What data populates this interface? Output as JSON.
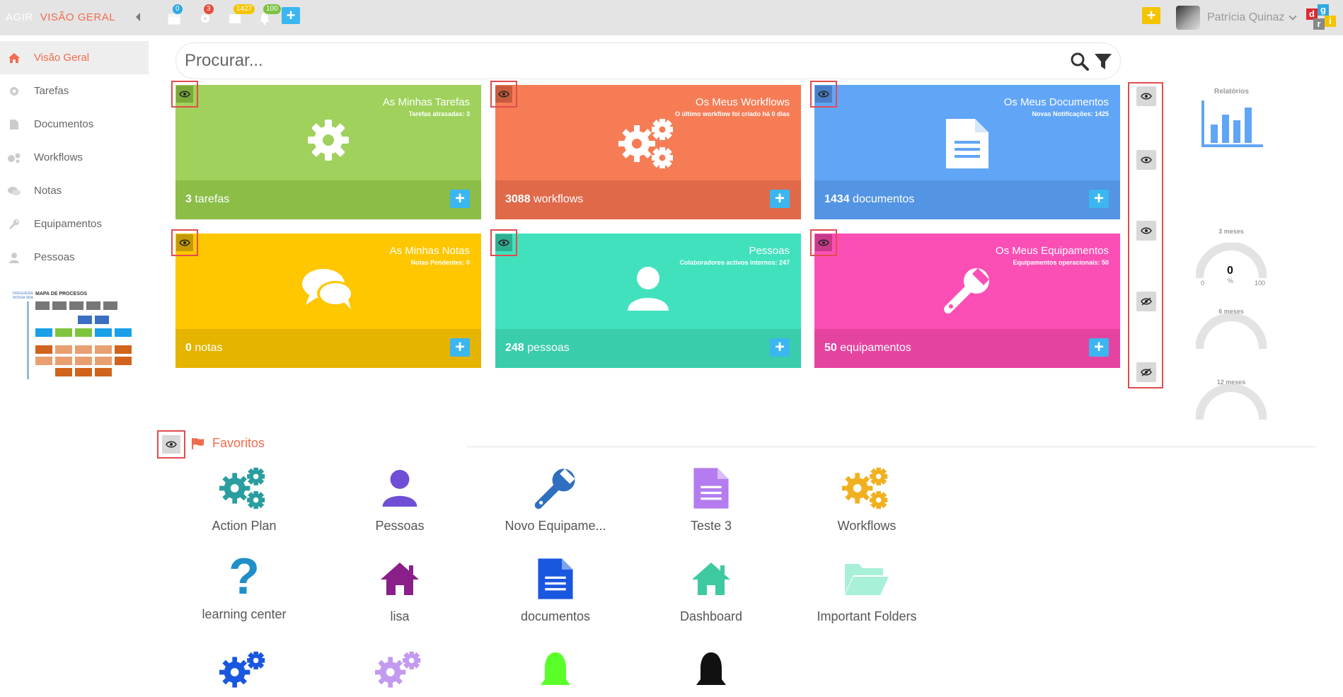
{
  "topbar": {
    "app_name": "AGIR",
    "breadcrumb": "VISÃO GERAL",
    "badges": {
      "calendar": "0",
      "tasks": "3",
      "documents": "1427",
      "notifications": "100"
    },
    "add_label": "+",
    "quick_add_label": "+",
    "user_name": "Patrícia Quinaz"
  },
  "sidebar": {
    "items": [
      {
        "label": "Visão Geral",
        "icon": "home-icon"
      },
      {
        "label": "Tarefas",
        "icon": "gear-icon"
      },
      {
        "label": "Documentos",
        "icon": "document-icon"
      },
      {
        "label": "Workflows",
        "icon": "gears-icon"
      },
      {
        "label": "Notas",
        "icon": "comments-icon"
      },
      {
        "label": "Equipamentos",
        "icon": "wrench-icon"
      },
      {
        "label": "Pessoas",
        "icon": "user-icon"
      }
    ],
    "process_map": {
      "title": "MAPA DE PROCESOS",
      "subtitle": "FREGUESIA NOSSA SRA"
    }
  },
  "search": {
    "placeholder": "Procurar..."
  },
  "tiles": [
    {
      "title": "As Minhas Tarefas",
      "subtitle": "Tarefas atrasadas: 3",
      "count": "3",
      "unit": "tarefas",
      "color": "#9fd15c",
      "bottom_color": "#8bbd47",
      "eye_color": "#7aa83b",
      "icon": "gear-icon"
    },
    {
      "title": "Os Meus Workflows",
      "subtitle": "O último workflow foi criado há 0 dias",
      "count": "3088",
      "unit": "workflows",
      "color": "#f67c56",
      "bottom_color": "#e0694a",
      "eye_color": "#c85b3c",
      "icon": "gears-icon"
    },
    {
      "title": "Os Meus Documentos",
      "subtitle": "Novas Notificações: 1425",
      "count": "1434",
      "unit": "documentos",
      "color": "#61a5f7",
      "bottom_color": "#5394e3",
      "eye_color": "#4a7fc7",
      "icon": "document-icon"
    },
    {
      "title": "As Minhas Notas",
      "subtitle": "Notas Pendentes: 0",
      "count": "0",
      "unit": "notas",
      "color": "#ffc700",
      "bottom_color": "#e5b400",
      "eye_color": "#c49a00",
      "icon": "comments-icon"
    },
    {
      "title": "Pessoas",
      "subtitle": "Colaboradores activos internos: 247",
      "count": "248",
      "unit": "pessoas",
      "color": "#41e1be",
      "bottom_color": "#39cdab",
      "eye_color": "#2fae90",
      "icon": "user-icon"
    },
    {
      "title": "Os Meus Equipamentos",
      "subtitle": "Equipamentos operacionais: 50",
      "count": "50",
      "unit": "equipamentos",
      "color": "#fb4fb5",
      "bottom_color": "#e4449f",
      "eye_color": "#c93a8a",
      "icon": "wrench-icon"
    }
  ],
  "right_panel": {
    "reports_label": "Relatórios",
    "gauges": [
      {
        "label": "3 meses",
        "value": "0",
        "unit": "%",
        "min": "0",
        "max": "100"
      },
      {
        "label": "6 meses"
      },
      {
        "label": "12 meses"
      }
    ],
    "visibility_toggles": [
      "visible",
      "visible",
      "visible",
      "hidden",
      "hidden"
    ]
  },
  "favorites": {
    "header": "Favoritos",
    "items": [
      {
        "label": "Action Plan",
        "icon": "gears-icon",
        "color": "#2a9d9f"
      },
      {
        "label": "Pessoas",
        "icon": "user-icon",
        "color": "#6e4fd6"
      },
      {
        "label": "Novo Equipame...",
        "icon": "wrench-icon",
        "color": "#2f6fbf"
      },
      {
        "label": "Teste 3",
        "icon": "document-icon",
        "color": "#b47cf0"
      },
      {
        "label": "Workflows",
        "icon": "gears-icon",
        "color": "#f0b020"
      },
      {
        "label": "learning center",
        "icon": "question-icon",
        "color": "#1e8fc8"
      },
      {
        "label": "lisa",
        "icon": "home-icon",
        "color": "#8a1f8a"
      },
      {
        "label": "documentos",
        "icon": "document-icon",
        "color": "#1a57e0"
      },
      {
        "label": "Dashboard",
        "icon": "home-icon",
        "color": "#3ec9a0"
      },
      {
        "label": "Important Folders",
        "icon": "folder-open-icon",
        "color": "#a8f0d8"
      },
      {
        "label": "",
        "icon": "gears-icon",
        "color": "#1a57e0"
      },
      {
        "label": "",
        "icon": "gears-icon",
        "color": "#c39af0"
      },
      {
        "label": "",
        "icon": "bell-icon",
        "color": "#5aff2a"
      },
      {
        "label": "",
        "icon": "bell-icon",
        "color": "#111111"
      }
    ]
  }
}
